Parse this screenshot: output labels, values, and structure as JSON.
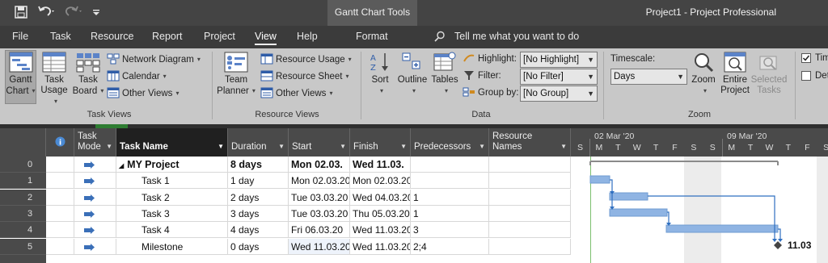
{
  "titlebar": {
    "contextual_tab": "Gantt Chart Tools",
    "title": "Project1  -  Project Professional"
  },
  "tabs": [
    "File",
    "Task",
    "Resource",
    "Report",
    "Project",
    "View",
    "Help",
    "Format"
  ],
  "tell_me": "Tell me what you want to do",
  "ribbon": {
    "task_views": {
      "label": "Task Views",
      "gantt_chart": [
        "Gantt",
        "Chart"
      ],
      "task_usage": [
        "Task",
        "Usage"
      ],
      "task_board": [
        "Task",
        "Board"
      ],
      "network_diagram": "Network Diagram",
      "calendar": "Calendar",
      "other_views": "Other Views"
    },
    "resource_views": {
      "label": "Resource Views",
      "team_planner": [
        "Team",
        "Planner"
      ],
      "resource_usage": "Resource Usage",
      "resource_sheet": "Resource Sheet",
      "other_views": "Other Views"
    },
    "data": {
      "label": "Data",
      "sort": "Sort",
      "outline": "Outline",
      "tables": "Tables",
      "highlight_label": "Highlight:",
      "highlight_value": "[No Highlight]",
      "filter_label": "Filter:",
      "filter_value": "[No Filter]",
      "group_label": "Group by:",
      "group_value": "[No Group]"
    },
    "zoom": {
      "label": "Zoom",
      "timescale_label": "Timescale:",
      "timescale_value": "Days",
      "zoom": "Zoom",
      "entire_project": [
        "Entire",
        "Project"
      ],
      "selected_tasks": [
        "Selected",
        "Tasks"
      ]
    },
    "split_view": {
      "timeline_partial": "Tim",
      "details_partial": "Det"
    }
  },
  "grid": {
    "columns": {
      "info": "i",
      "mode": [
        "Task",
        "Mode"
      ],
      "name": "Task Name",
      "duration": "Duration",
      "start": "Start",
      "finish": "Finish",
      "predecessors": "Predecessors",
      "resources": [
        "Resource",
        "Names"
      ]
    },
    "rows": [
      {
        "id": "0",
        "name": "MY Project",
        "duration": "8 days",
        "start": "Mon 02.03.",
        "finish": "Wed 11.03.",
        "pred": "",
        "summary": true
      },
      {
        "id": "1",
        "name": "Task 1",
        "duration": "1 day",
        "start": "Mon 02.03.20",
        "finish": "Mon 02.03.20",
        "pred": "",
        "summary": false
      },
      {
        "id": "2",
        "name": "Task 2",
        "duration": "2 days",
        "start": "Tue 03.03.20",
        "finish": "Wed 04.03.20",
        "pred": "1",
        "summary": false
      },
      {
        "id": "3",
        "name": "Task 3",
        "duration": "3 days",
        "start": "Tue 03.03.20",
        "finish": "Thu 05.03.20",
        "pred": "1",
        "summary": false
      },
      {
        "id": "4",
        "name": "Task 4",
        "duration": "4 days",
        "start": "Fri 06.03.20",
        "finish": "Wed 11.03.20",
        "pred": "3",
        "summary": false
      },
      {
        "id": "5",
        "name": "Milestone",
        "duration": "0 days",
        "start": "Wed 11.03.20",
        "finish": "Wed 11.03.20",
        "pred": "2;4",
        "summary": false
      }
    ]
  },
  "gantt": {
    "weeks": [
      "02 Mar '20",
      "09 Mar '20"
    ],
    "days": [
      "S",
      "M",
      "T",
      "W",
      "T",
      "F",
      "S",
      "S",
      "M",
      "T",
      "W",
      "T",
      "F",
      "S"
    ],
    "milestone_label": "11.03",
    "colors": {
      "bar": "#8fb4e3",
      "link": "#2f6fc0",
      "summary": "#888888"
    }
  }
}
